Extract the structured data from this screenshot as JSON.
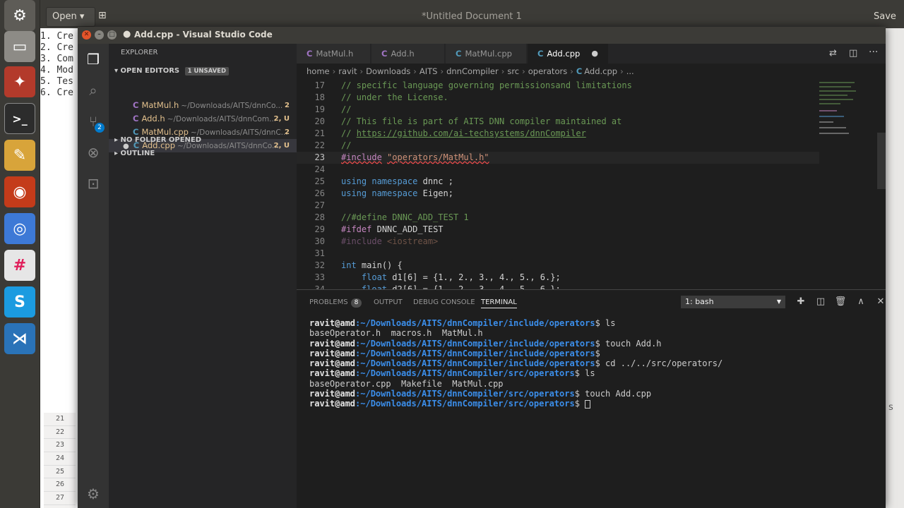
{
  "gedit": {
    "open_label": "Open",
    "title": "*Untitled Document 1",
    "save_label": "Save",
    "lines": [
      "1. Cre",
      "2. Cre",
      "3. Com",
      "4. Mod",
      "5. Tes",
      "6. Cre"
    ],
    "gutter": [
      "21",
      "22",
      "23",
      "24",
      "25",
      "26",
      "27"
    ],
    "edge_text": "s"
  },
  "vscode": {
    "title": "Add.cpp - Visual Studio Code",
    "explorer_label": "EXPLORER",
    "open_editors_label": "OPEN EDITORS",
    "unsaved_badge": "1 UNSAVED",
    "open_editors": [
      {
        "icon": "C",
        "name": "MatMul.h",
        "path": "~/Downloads/AITS/dnnCo...",
        "badge": "2"
      },
      {
        "icon": "C",
        "name": "Add.h",
        "path": "~/Downloads/AITS/dnnCom...",
        "badge": "2, U"
      },
      {
        "icon": "C",
        "name": "MatMul.cpp",
        "path": "~/Downloads/AITS/dnnC...",
        "badge": "2"
      },
      {
        "icon": "C",
        "name": "Add.cpp",
        "path": "~/Downloads/AITS/dnnCo...",
        "badge": "2, U"
      }
    ],
    "no_folder_label": "NO FOLDER OPENED",
    "outline_label": "OUTLINE",
    "scm_badge": "2",
    "tabs": [
      {
        "icon": "C",
        "label": "MatMul.h"
      },
      {
        "icon": "C",
        "label": "Add.h"
      },
      {
        "icon": "C",
        "label": "MatMul.cpp"
      },
      {
        "icon": "C",
        "label": "Add.cpp"
      }
    ],
    "breadcrumb": [
      "home",
      "ravit",
      "Downloads",
      "AITS",
      "dnnCompiler",
      "src",
      "operators",
      "Add.cpp",
      "..."
    ],
    "code": {
      "l17": "// specific language governing permissionsand limitations",
      "l18": "// under the License.",
      "l19": "//",
      "l20": "// This file is part of AITS DNN compiler maintained at",
      "l21_pre": "// ",
      "l21_link": "https://github.com/ai-techsystems/dnnCompiler",
      "l22": "//",
      "l23_a": "#include",
      "l23_b": "\"operators/MatMul.h\"",
      "l25_kw1": "using",
      "l25_kw2": "namespace",
      "l25_rest": "dnnc ;",
      "l26_rest": "Eigen;",
      "l28": "//#define DNNC_ADD_TEST 1",
      "l29_a": "#ifdef",
      "l29_b": "DNNC_ADD_TEST",
      "l30_a": "#include",
      "l30_b": "<iostream>",
      "l32_a": "int",
      "l32_b": "main() {",
      "l33_a": "float",
      "l33_b": "d1[6] = {1., 2., 3., 4., 5., 6.};",
      "l34_b": "d2[6] = {1., 2., 3., 4., 5., 6.};"
    },
    "line_numbers": [
      "17",
      "18",
      "19",
      "20",
      "21",
      "22",
      "23",
      "24",
      "25",
      "26",
      "27",
      "28",
      "29",
      "30",
      "31",
      "32",
      "33",
      "34"
    ],
    "panel": {
      "problems_label": "PROBLEMS",
      "problems_count": "8",
      "output_label": "OUTPUT",
      "debug_label": "DEBUG CONSOLE",
      "terminal_label": "TERMINAL",
      "terminal_select": "1: bash"
    },
    "terminal": [
      {
        "user": "ravit@amd",
        "path": ":~/Downloads/AITS/dnnCompiler/include/operators",
        "cmd": "$ ls"
      },
      {
        "out": "baseOperator.h  macros.h  MatMul.h"
      },
      {
        "user": "ravit@amd",
        "path": ":~/Downloads/AITS/dnnCompiler/include/operators",
        "cmd": "$ touch Add.h"
      },
      {
        "user": "ravit@amd",
        "path": ":~/Downloads/AITS/dnnCompiler/include/operators",
        "cmd": "$"
      },
      {
        "user": "ravit@amd",
        "path": ":~/Downloads/AITS/dnnCompiler/include/operators",
        "cmd": "$ cd ../../src/operators/"
      },
      {
        "user": "ravit@amd",
        "path": ":~/Downloads/AITS/dnnCompiler/src/operators",
        "cmd": "$ ls"
      },
      {
        "out": "baseOperator.cpp  Makefile  MatMul.cpp"
      },
      {
        "user": "ravit@amd",
        "path": ":~/Downloads/AITS/dnnCompiler/src/operators",
        "cmd": "$ touch Add.cpp"
      },
      {
        "user": "ravit@amd",
        "path": ":~/Downloads/AITS/dnnCompiler/src/operators",
        "cmd": "$ "
      }
    ]
  },
  "colors": {
    "accent": "#007acc",
    "unsaved": "#e2c08d",
    "terminal_path": "#3b8eea"
  }
}
